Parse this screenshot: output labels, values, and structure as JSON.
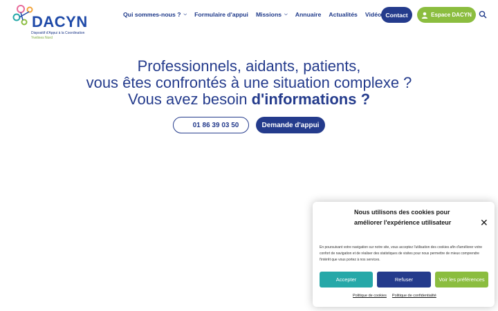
{
  "logo": {
    "brand": "DACYN",
    "subtitle": "Dispositif d'Appui à la Coordination",
    "region": "Yvelines Nord"
  },
  "nav": {
    "items": [
      {
        "label": "Qui sommes-nous ?",
        "has_dropdown": true
      },
      {
        "label": "Formulaire d'appui",
        "has_dropdown": false
      },
      {
        "label": "Missions",
        "has_dropdown": true
      },
      {
        "label": "Annuaire",
        "has_dropdown": false
      },
      {
        "label": "Actualités",
        "has_dropdown": false
      },
      {
        "label": "Vidéos",
        "has_dropdown": false
      }
    ],
    "contact_label": "Contact",
    "espace_label": "Espace DACYN"
  },
  "hero": {
    "line1": "Professionnels, aidants, patients,",
    "line2": "vous êtes confrontés à une situation complexe ?",
    "line3_prefix": "Vous avez besoin ",
    "line3_bold": "d'informations ?",
    "phone": "01 86 39 03 50",
    "demande_label": "Demande d'appui"
  },
  "cookie": {
    "title": "Nous utilisons des cookies pour améliorer l'expérience utilisateur",
    "text": "En poursuivant votre navigation sur notre site, vous acceptez l'utilisation des cookies afin d'améliorer votre confort de navigation et de réaliser des statistiques de visites pour nous permettre de mieux comprendre l'intérêt que vous portez à nos services.",
    "accept_label": "Accepter",
    "refuse_label": "Refuser",
    "prefs_label": "Voir les préférences",
    "link_cookies": "Politique de cookies",
    "link_privacy": "Politique de confidentialité"
  },
  "colors": {
    "primary": "#243b8c",
    "green": "#8bbd3f",
    "teal": "#26a8a8"
  },
  "icons": [
    "user-icon",
    "search-icon",
    "phone-icon",
    "close-icon",
    "chevron-down-icon"
  ]
}
